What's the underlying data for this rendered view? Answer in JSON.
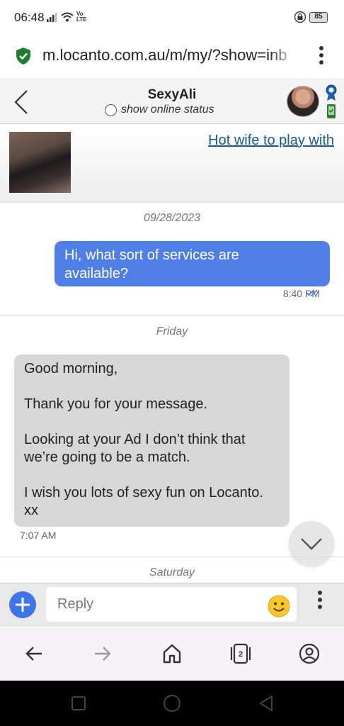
{
  "status_bar": {
    "time": "06:48",
    "network": "Vo LTE",
    "battery": "85",
    "icons": [
      "signal-icon",
      "wifi-icon",
      "volte-icon",
      "lock-icon",
      "battery-icon"
    ]
  },
  "browser": {
    "url": "m.locanto.com.au/m/my/?show=inb",
    "nav": [
      "back-arrow-icon",
      "forward-arrow-icon",
      "home-icon",
      "tabs-icon",
      "account-icon"
    ],
    "tab_count": "2"
  },
  "chat_header": {
    "contact_name": "SexyAli",
    "online_status_label": "show online status"
  },
  "ad": {
    "title": "Hot wife to play with"
  },
  "messages": [
    {
      "date": "09/28/2023",
      "direction": "outgoing",
      "lines": [
        "Hi, what sort of services are",
        "available?"
      ],
      "time": "8:40 PM",
      "read": true
    },
    {
      "date": "Friday",
      "direction": "incoming",
      "paragraphs": [
        "Good morning,",
        "Thank you for your message.",
        "Looking at your Ad I don’t think that we’re going to be a match.",
        "I wish you lots of sexy fun on Locanto. xx"
      ],
      "time": "7:07 AM"
    },
    {
      "date": "Saturday"
    }
  ],
  "reply": {
    "placeholder": "Reply"
  },
  "colors": {
    "outgoing_bubble": "#4f7fe6",
    "incoming_bubble": "#d7d7d7",
    "link": "#1a5a8c",
    "add_button": "#3f74e6"
  }
}
